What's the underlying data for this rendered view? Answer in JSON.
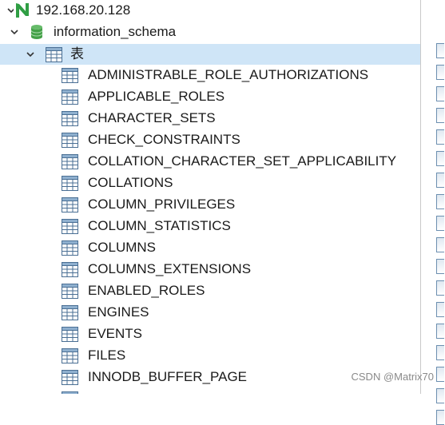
{
  "server": {
    "label": "192.168.20.128",
    "icon": "mysql-dolphin-icon",
    "icon_color": "#2f9e44"
  },
  "database": {
    "label": "information_schema",
    "icon": "database-icon",
    "icon_color": "#4caf50"
  },
  "tables_folder": {
    "label": "表",
    "icon": "table-icon"
  },
  "tables": [
    "ADMINISTRABLE_ROLE_AUTHORIZATIONS",
    "APPLICABLE_ROLES",
    "CHARACTER_SETS",
    "CHECK_CONSTRAINTS",
    "COLLATION_CHARACTER_SET_APPLICABILITY",
    "COLLATIONS",
    "COLUMN_PRIVILEGES",
    "COLUMN_STATISTICS",
    "COLUMNS",
    "COLUMNS_EXTENSIONS",
    "ENABLED_ROLES",
    "ENGINES",
    "EVENTS",
    "FILES",
    "INNODB_BUFFER_PAGE"
  ],
  "watermark": "CSDN @Matrix70",
  "colors": {
    "selection": "#cfe5f7",
    "table_icon": "#4a6f94"
  }
}
